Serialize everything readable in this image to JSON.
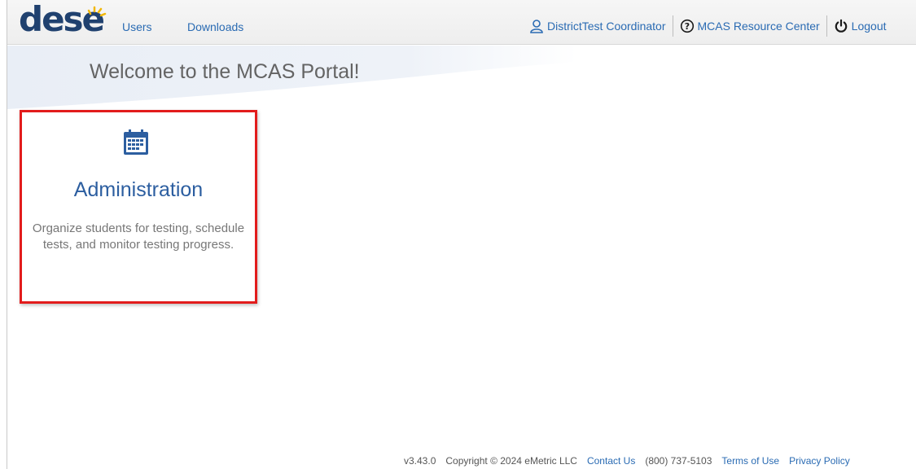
{
  "header": {
    "logo": "dese",
    "nav": [
      {
        "label": "Users"
      },
      {
        "label": "Downloads"
      }
    ],
    "user": {
      "label": "DistrictTest Coordinator",
      "icon": "user-icon"
    },
    "resource": {
      "label": "MCAS Resource Center",
      "icon": "help-circle-icon"
    },
    "logout": {
      "label": "Logout",
      "icon": "power-icon"
    }
  },
  "banner": {
    "welcome": "Welcome to the MCAS Portal!"
  },
  "cards": [
    {
      "title": "Administration",
      "description": "Organize students for testing, schedule tests, and monitor testing progress.",
      "icon": "calendar-icon",
      "highlight_color": "#e21c1c"
    }
  ],
  "footer": {
    "version": "v3.43.0",
    "copyright": "Copyright © 2024 eMetric LLC",
    "contact": "Contact Us",
    "phone": "(800) 737-5103",
    "terms": "Terms of Use",
    "privacy": "Privacy Policy"
  },
  "colors": {
    "link": "#2a6bb3",
    "brand": "#20416f",
    "accent_yellow": "#f2b705",
    "highlight": "#e21c1c"
  }
}
